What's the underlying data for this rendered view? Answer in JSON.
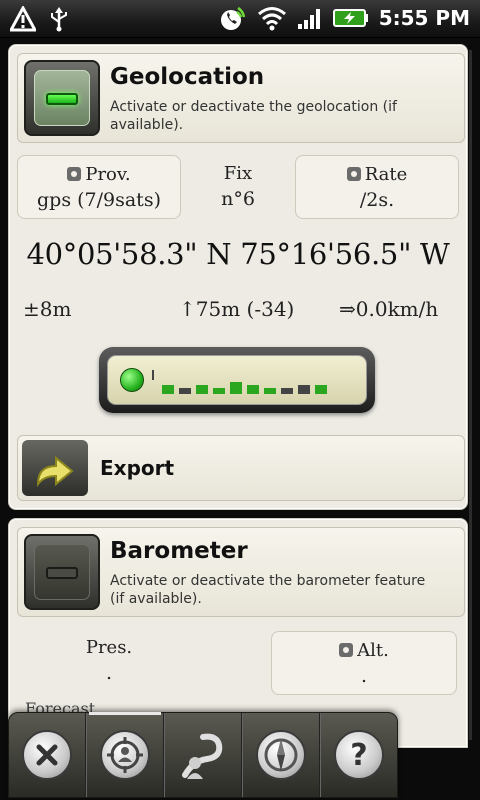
{
  "status_bar": {
    "time": "5:55 PM",
    "icons": [
      "warning-icon",
      "usb-icon",
      "phone-signal-icon",
      "wifi-icon",
      "cell-signal-icon",
      "battery-charging-icon"
    ]
  },
  "geolocation": {
    "title": "Geolocation",
    "description": "Activate or deactivate the geolocation (if available).",
    "enabled": true,
    "provider": {
      "label": "Prov.",
      "value": "gps (7/9sats)"
    },
    "fix": {
      "label": "Fix",
      "value": "n°6"
    },
    "rate": {
      "label": "Rate",
      "value": "/2s."
    },
    "coordinates": "40°05'58.3\" N 75°16'56.5\" W",
    "accuracy": "±8m",
    "altitude": "↑75m (-34)",
    "speed": "⇒0.0km/h",
    "signal_bars": [
      3,
      2,
      3,
      2,
      4,
      3,
      2,
      2,
      3,
      3
    ],
    "signal_active": [
      true,
      false,
      true,
      true,
      true,
      true,
      true,
      false,
      false,
      true
    ],
    "export_label": "Export"
  },
  "barometer": {
    "title": "Barometer",
    "description": "Activate or deactivate the barometer feature (if available).",
    "enabled": false,
    "pressure": {
      "label": "Pres.",
      "value": "."
    },
    "altitude": {
      "label": "Alt.",
      "value": "."
    },
    "forecast_label": "Forecast"
  },
  "toolbar": {
    "items": [
      "close-icon",
      "geolocation-icon",
      "track-icon",
      "compass-icon",
      "help-icon"
    ],
    "active_index": 1
  },
  "colors": {
    "led_on": "#3bd62e",
    "panel_bg": "#edebe3",
    "toolbar_bg": "#3f3f38"
  }
}
